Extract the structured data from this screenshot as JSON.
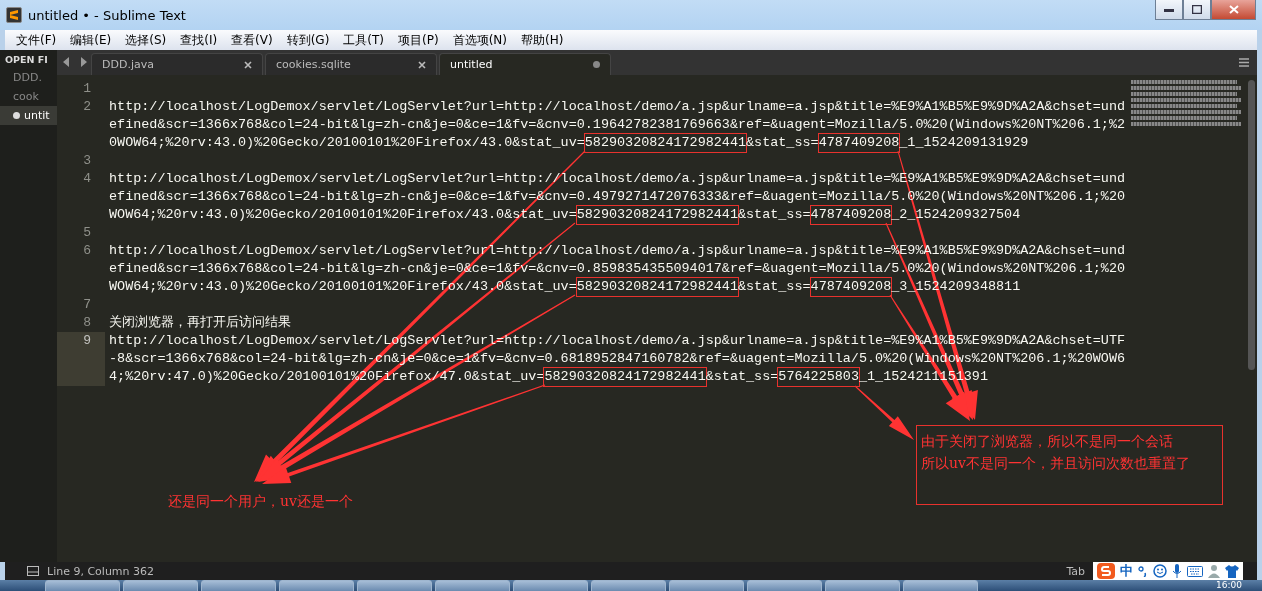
{
  "window": {
    "title": "untitled • - Sublime Text"
  },
  "menu": [
    "文件(F)",
    "编辑(E)",
    "选择(S)",
    "查找(I)",
    "查看(V)",
    "转到(G)",
    "工具(T)",
    "项目(P)",
    "首选项(N)",
    "帮助(H)"
  ],
  "sidebar": {
    "header": "OPEN FI",
    "items": [
      {
        "label": "DDD.",
        "selected": false,
        "dirty": false
      },
      {
        "label": "cook",
        "selected": false,
        "dirty": false
      },
      {
        "label": "untit",
        "selected": true,
        "dirty": true
      }
    ]
  },
  "tabs": [
    {
      "label": "DDD.java",
      "selected": false,
      "dirty": false
    },
    {
      "label": "cookies.sqlite",
      "selected": false,
      "dirty": false
    },
    {
      "label": "untitled",
      "selected": true,
      "dirty": true
    }
  ],
  "lines": [
    {
      "number": "1",
      "current": false
    },
    {
      "number": "2",
      "current": false,
      "rows": [
        [
          {
            "text": "http://localhost/LogDemox/servlet/LogServlet?url=http://localhost/demo/a.jsp&urlname=a.jsp&title=%E9%A1%B5%E9%9D%A2A&chset=und",
            "boxed": false
          }
        ],
        [
          {
            "text": "efined&scr=1366x768&col=24-bit&lg=zh-cn&je=0&ce=1&fv=&cnv=0.19642782381769663&ref=&uagent=Mozilla/5.0%20(Windows%20NT%206.1;%2",
            "boxed": false
          }
        ],
        [
          {
            "text": "0WOW64;%20rv:43.0)%20Gecko/20100101%20Firefox/43.0&stat_uv=",
            "boxed": false
          },
          {
            "text": "58290320824172982441",
            "boxed": true
          },
          {
            "text": "&stat_ss=",
            "boxed": false
          },
          {
            "text": "4787409208",
            "boxed": true
          },
          {
            "text": "_1_1524209131929",
            "boxed": false
          }
        ]
      ]
    },
    {
      "number": "3",
      "current": false
    },
    {
      "number": "4",
      "current": false,
      "rows": [
        [
          {
            "text": "http://localhost/LogDemox/servlet/LogServlet?url=http://localhost/demo/a.jsp&urlname=a.jsp&title=%E9%A1%B5%E9%9D%A2A&chset=und",
            "boxed": false
          }
        ],
        [
          {
            "text": "efined&scr=1366x768&col=24-bit&lg=zh-cn&je=0&ce=1&fv=&cnv=0.4979271472076333&ref=&uagent=Mozilla/5.0%20(Windows%20NT%206.1;%20",
            "boxed": false
          }
        ],
        [
          {
            "text": "WOW64;%20rv:43.0)%20Gecko/20100101%20Firefox/43.0&stat_uv=",
            "boxed": false
          },
          {
            "text": "58290320824172982441",
            "boxed": true
          },
          {
            "text": "&stat_ss=",
            "boxed": false
          },
          {
            "text": "4787409208",
            "boxed": true
          },
          {
            "text": "_2_1524209327504",
            "boxed": false
          }
        ]
      ]
    },
    {
      "number": "5",
      "current": false
    },
    {
      "number": "6",
      "current": false,
      "rows": [
        [
          {
            "text": "http://localhost/LogDemox/servlet/LogServlet?url=http://localhost/demo/a.jsp&urlname=a.jsp&title=%E9%A1%B5%E9%9D%A2A&chset=und",
            "boxed": false
          }
        ],
        [
          {
            "text": "efined&scr=1366x768&col=24-bit&lg=zh-cn&je=0&ce=1&fv=&cnv=0.8598354355094017&ref=&uagent=Mozilla/5.0%20(Windows%20NT%206.1;%20",
            "boxed": false
          }
        ],
        [
          {
            "text": "WOW64;%20rv:43.0)%20Gecko/20100101%20Firefox/43.0&stat_uv=",
            "boxed": false
          },
          {
            "text": "58290320824172982441",
            "boxed": true
          },
          {
            "text": "&stat_ss=",
            "boxed": false
          },
          {
            "text": "4787409208",
            "boxed": true
          },
          {
            "text": "_3_1524209348811",
            "boxed": false
          }
        ]
      ]
    },
    {
      "number": "7",
      "current": false
    },
    {
      "number": "8",
      "current": false,
      "rows": [
        [
          {
            "text": "关闭浏览器，再打开后访问结果",
            "boxed": false
          }
        ]
      ]
    },
    {
      "number": "9",
      "current": true,
      "rows": [
        [
          {
            "text": "http://localhost/LogDemox/servlet/LogServlet?url=http://localhost/demo/a.jsp&urlname=a.jsp&title=%E9%A1%B5%E9%9D%A2A&chset=UTF",
            "boxed": false
          }
        ],
        [
          {
            "text": "-8&scr=1366x768&col=24-bit&lg=zh-cn&je=0&ce=1&fv=&cnv=0.6818952847160782&ref=&uagent=Mozilla/5.0%20(Windows%20NT%206.1;%20WOW6",
            "boxed": false
          }
        ],
        [
          {
            "text": "4;%20rv:47.0)%20Gecko/20100101%20Firefox/47.0&stat_uv=",
            "boxed": false
          },
          {
            "text": "58290320824172982441",
            "boxed": true
          },
          {
            "text": "&stat_ss=",
            "boxed": false
          },
          {
            "text": "5764225803",
            "boxed": true
          },
          {
            "text": "_1_1524211151391",
            "boxed": false
          }
        ]
      ]
    }
  ],
  "annotations": [
    {
      "kind": "label",
      "lines": [
        "还是同一个用户，uv还是一个"
      ]
    },
    {
      "kind": "callout",
      "lines": [
        "由于关闭了浏览器，所以不是同一个会话",
        "所以uv不是同一个，并且访问次数也重置了"
      ]
    }
  ],
  "status_bar": {
    "position": "Line 9, Column 362",
    "indent": "Tab"
  },
  "ime": {
    "mode": "中"
  },
  "taskbar": {
    "clock": "16:00"
  }
}
